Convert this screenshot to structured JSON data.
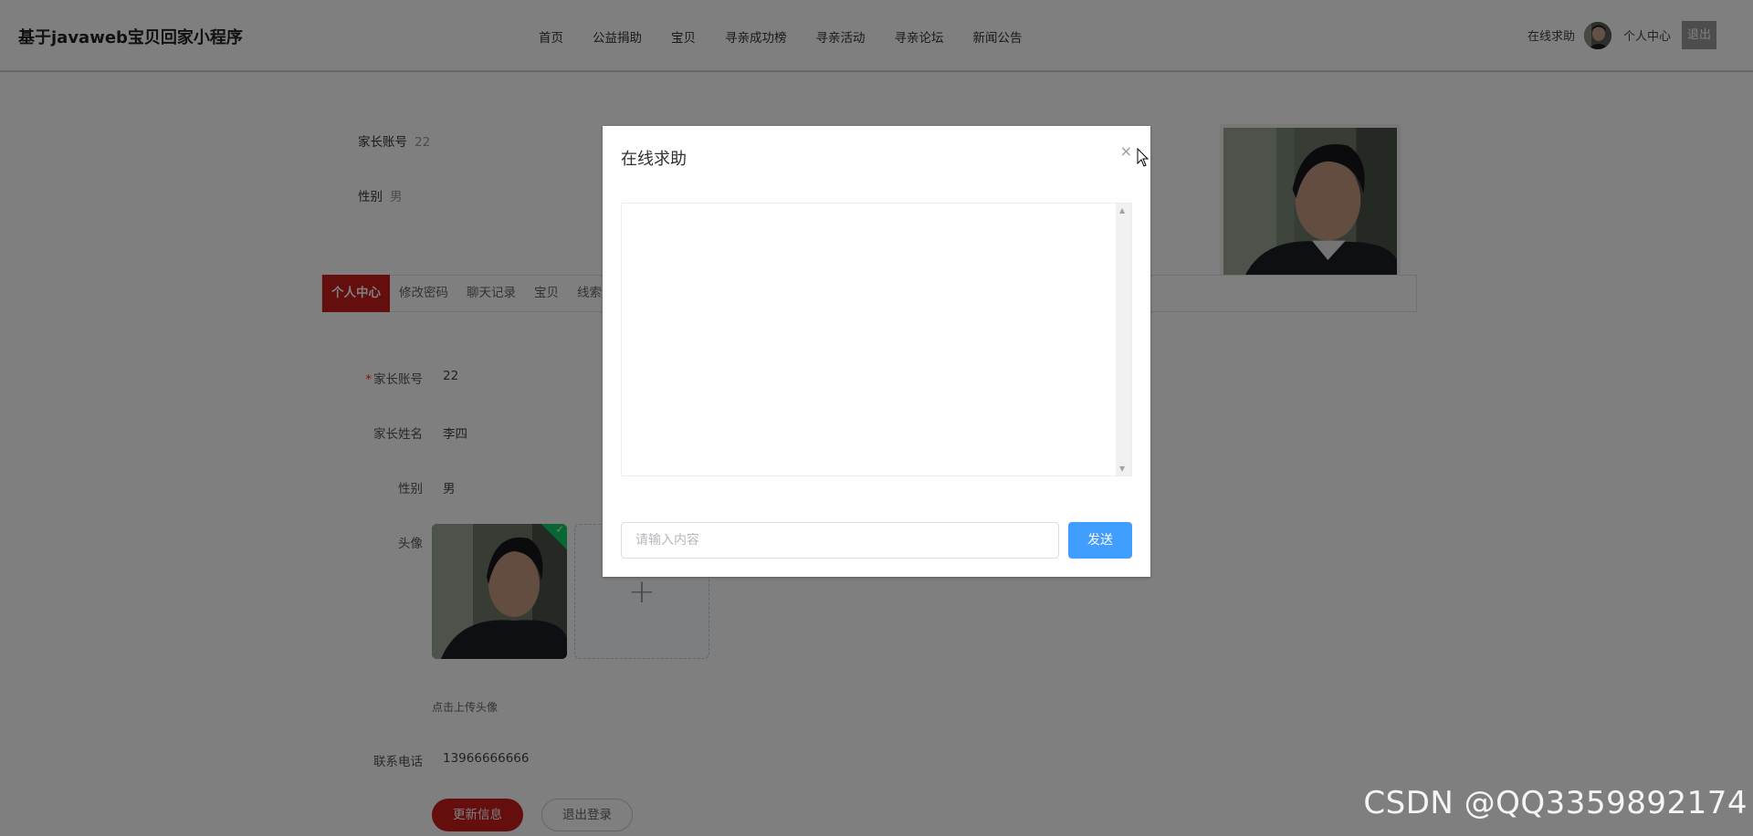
{
  "header": {
    "brand": "基于javaweb宝贝回家小程序",
    "nav": [
      "首页",
      "公益捐助",
      "宝贝",
      "寻亲成功榜",
      "寻亲活动",
      "寻亲论坛",
      "新闻公告"
    ],
    "help": "在线求助",
    "center": "个人中心",
    "logout": "退出"
  },
  "profile": {
    "account_label": "家长账号",
    "account_value": "22",
    "gender_label": "性别",
    "gender_value": "男"
  },
  "tabs": [
    "个人中心",
    "修改密码",
    "聊天记录",
    "宝贝",
    "线索"
  ],
  "form": {
    "account_label": "家长账号",
    "account_value": "22",
    "name_label": "家长姓名",
    "name_value": "李四",
    "gender_label": "性别",
    "gender_value": "男",
    "avatar_label": "头像",
    "upload_plus": "+",
    "upload_check": "✓",
    "upload_tip": "点击上传头像",
    "phone_label": "联系电话",
    "phone_value": "13966666666",
    "update_btn": "更新信息",
    "logout_btn": "退出登录"
  },
  "modal": {
    "title": "在线求助",
    "close": "×",
    "input_placeholder": "请输入内容",
    "send": "发送"
  },
  "watermark": "CSDN @QQ3359892174",
  "colors": {
    "accent": "#c81c1c",
    "send_button": "#409eff",
    "overlay": "rgba(0,0,0,0.5)"
  }
}
